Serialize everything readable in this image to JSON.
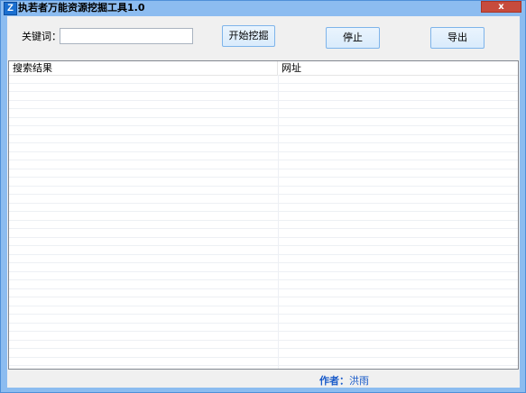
{
  "window": {
    "title": "执若者万能资源挖掘工具1.0",
    "icon": "Z",
    "close_label": "x"
  },
  "form": {
    "keyword_label": "关键词：",
    "keyword_value": "",
    "keyword_placeholder": ""
  },
  "buttons": {
    "start": "开始挖掘",
    "stop": "停止",
    "export": "导出"
  },
  "table": {
    "columns": [
      "搜索结果",
      "网址"
    ],
    "rows": []
  },
  "footer": {
    "author_label": "作者：",
    "author_name": "洪雨"
  },
  "colors": {
    "window_frame": "#8cbcf0",
    "author_text": "#1a5bc9",
    "close_button": "#c74b3d"
  }
}
